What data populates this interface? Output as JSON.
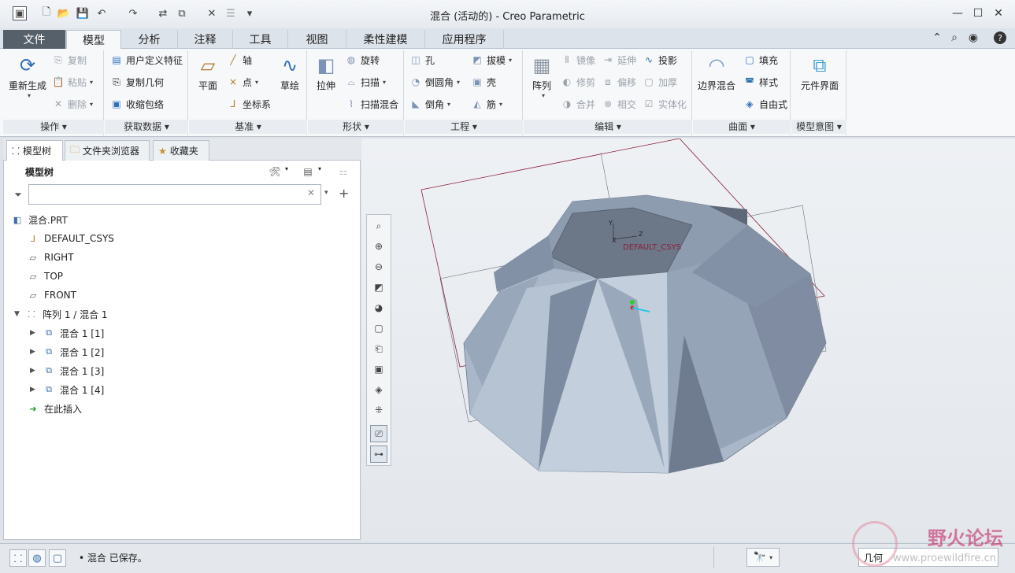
{
  "window": {
    "title": "混合 (活动的) - Creo Parametric"
  },
  "quick_access": [
    "new-icon",
    "open-icon",
    "save-icon",
    "undo-icon",
    "redo-icon",
    "regenerate-icon",
    "windows-icon",
    "close-icon",
    "shortcut-icon",
    "customize-icon"
  ],
  "tabs": [
    {
      "label": "文件"
    },
    {
      "label": "模型"
    },
    {
      "label": "分析"
    },
    {
      "label": "注释"
    },
    {
      "label": "工具"
    },
    {
      "label": "视图"
    },
    {
      "label": "柔性建模"
    },
    {
      "label": "应用程序"
    }
  ],
  "ribbon": {
    "operations": {
      "regenerate": "重新生成",
      "copy": "复制",
      "paste": "粘贴",
      "delete": "删除",
      "label": "操作"
    },
    "get_data": {
      "udf": "用户定义特征",
      "copy_geom": "复制几何",
      "shrinkwrap": "收缩包络",
      "label": "获取数据"
    },
    "datum": {
      "plane": "平面",
      "axis": "轴",
      "point": "点",
      "csys": "坐标系",
      "sketch": "草绘",
      "label": "基准"
    },
    "shapes": {
      "extrude": "拉伸",
      "revolve": "旋转",
      "sweep": "扫描",
      "swept_blend": "扫描混合",
      "label": "形状"
    },
    "engineering": {
      "hole": "孔",
      "round": "倒圆角",
      "chamfer": "倒角",
      "draft": "拔模",
      "shell": "壳",
      "rib": "筋",
      "label": "工程"
    },
    "editing": {
      "pattern": "阵列",
      "mirror": "镜像",
      "trim": "修剪",
      "merge": "合并",
      "extend": "延伸",
      "offset": "偏移",
      "intersect": "相交",
      "project": "投影",
      "thicken": "加厚",
      "solidify": "实体化",
      "label": "编辑"
    },
    "surfaces": {
      "boundary_blend": "边界混合",
      "fill": "填充",
      "style": "样式",
      "freestyle": "自由式",
      "label": "曲面"
    },
    "model_intent": {
      "component_interface": "元件界面",
      "label": "模型意图"
    }
  },
  "pane_tabs": {
    "model_tree": "模型树",
    "folder_browser": "文件夹浏览器",
    "favorites": "收藏夹"
  },
  "model_tree": {
    "header": "模型树",
    "search_placeholder": "",
    "items": [
      {
        "label": "混合.PRT"
      },
      {
        "label": "DEFAULT_CSYS"
      },
      {
        "label": "RIGHT"
      },
      {
        "label": "TOP"
      },
      {
        "label": "FRONT"
      },
      {
        "label": "阵列 1 / 混合 1"
      },
      {
        "label": "混合 1 [1]"
      },
      {
        "label": "混合 1 [2]"
      },
      {
        "label": "混合 1 [3]"
      },
      {
        "label": "混合 1 [4]"
      },
      {
        "label": "在此插入"
      }
    ]
  },
  "viewport": {
    "csys_label": "DEFAULT_CSYS",
    "axis_labels": {
      "y": "Y",
      "x": "X",
      "z": "Z"
    }
  },
  "status": {
    "message": "混合 已保存。",
    "filter": "几何"
  },
  "watermark": {
    "cn": "野火论坛",
    "url": "www.proewildfire.cn"
  },
  "colors": {
    "file_tab": "#56606a",
    "model_surface": "#a7b6c9",
    "datum_plane": "#8a1f3a"
  }
}
